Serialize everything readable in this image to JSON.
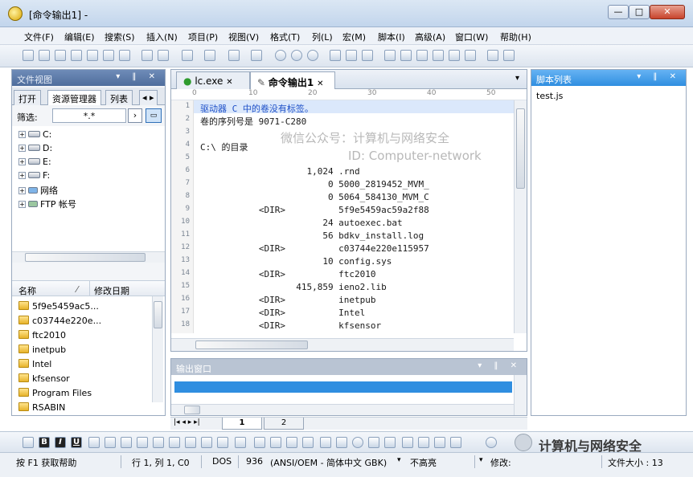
{
  "window": {
    "title": "[命令输出1] -",
    "minimize": "—",
    "maximize": "□",
    "close": "✕"
  },
  "menu": [
    "文件(F)",
    "编辑(E)",
    "搜索(S)",
    "插入(N)",
    "项目(P)",
    "视图(V)",
    "格式(T)",
    "列(L)",
    "宏(M)",
    "脚本(I)",
    "高级(A)",
    "窗口(W)",
    "帮助(H)"
  ],
  "file_view": {
    "title": "文件视图",
    "tabs": [
      "打开",
      "资源管理器",
      "列表"
    ],
    "filter_label": "筛选:",
    "filter_value": "*.*",
    "tree": [
      "C:",
      "D:",
      "E:",
      "F:",
      "网络",
      "FTP 帐号"
    ],
    "columns": [
      "名称",
      "修改日期"
    ],
    "files": [
      "5f9e5459ac5...",
      "c03744e220e...",
      "ftc2010",
      "inetpub",
      "Intel",
      "kfsensor",
      "Program Files",
      "RSABIN"
    ]
  },
  "editor": {
    "tabs": [
      "lc.exe",
      "命令输出1"
    ],
    "ruler": [
      "0",
      "10",
      "20",
      "30",
      "40",
      "50"
    ],
    "lines": [
      {
        "n": "1",
        "text": "驱动器 C 中的卷没有标签。"
      },
      {
        "n": "2",
        "text": "卷的序列号是 9071-C280"
      },
      {
        "n": "3",
        "text": ""
      },
      {
        "n": "4",
        "text": "C:\\ 的目录"
      },
      {
        "n": "5",
        "text": ""
      },
      {
        "n": "6",
        "text": "                    1,024 .rnd"
      },
      {
        "n": "7",
        "text": "                        0 5000_2819452_MVM_"
      },
      {
        "n": "8",
        "text": "                        0 5064_584130_MVM_C"
      },
      {
        "n": "9",
        "text": "           <DIR>          5f9e5459ac59a2f88"
      },
      {
        "n": "10",
        "text": "                       24 autoexec.bat"
      },
      {
        "n": "11",
        "text": "                       56 bdkv_install.log"
      },
      {
        "n": "12",
        "text": "           <DIR>          c03744e220e115957"
      },
      {
        "n": "13",
        "text": "                       10 config.sys"
      },
      {
        "n": "14",
        "text": "           <DIR>          ftc2010"
      },
      {
        "n": "15",
        "text": "                  415,859 ieno2.lib"
      },
      {
        "n": "16",
        "text": "           <DIR>          inetpub"
      },
      {
        "n": "17",
        "text": "           <DIR>          Intel"
      },
      {
        "n": "18",
        "text": "           <DIR>          kfsensor"
      }
    ],
    "watermark1": "微信公众号：计算机与网络安全",
    "watermark2": "ID: Computer-network"
  },
  "output": {
    "title": "输出窗口"
  },
  "sheets": [
    "1",
    "2"
  ],
  "script_list": {
    "title": "脚本列表",
    "items": [
      "test.js"
    ]
  },
  "status": {
    "help": "按 F1 获取帮助",
    "position": "行 1, 列 1, C0",
    "format": "DOS",
    "encoding_code": "936",
    "encoding": "(ANSI/OEM - 简体中文 GBK)",
    "highlight": "不高亮",
    "modified": "修改:",
    "filesize": "文件大小 : 13"
  },
  "brand_watermark": "计算机与网络安全"
}
